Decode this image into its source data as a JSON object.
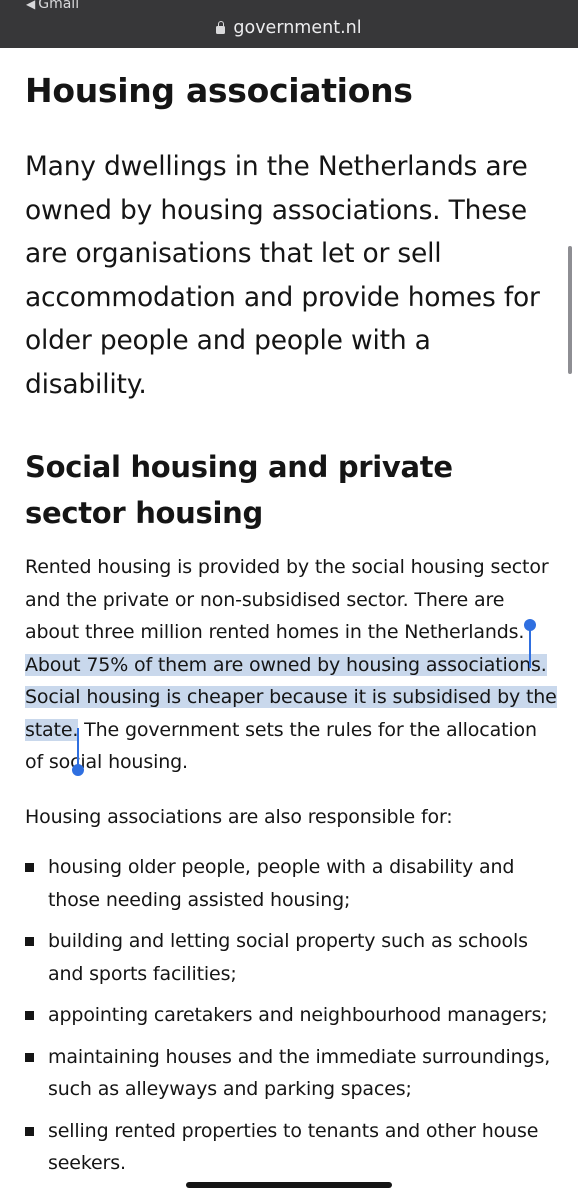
{
  "status_bar": {
    "back_label": "Gmail"
  },
  "browser": {
    "url": "government.nl"
  },
  "page": {
    "title": "Housing associations",
    "intro": "Many dwellings in the Netherlands are owned by housing associations. These are organisations that let or sell accommodation and provide homes for older people and people with a disability.",
    "section_heading": "Social housing and private sector housing",
    "paragraph": {
      "before_selection": "Rented housing is provided by the social housing sector and the private or non-subsidised sector. There are about three million rented homes in the Netherlands. ",
      "selected": "About 75% of them are owned by housing associations. Social housing is cheaper because it is subsidised by the state.",
      "after_selection": " The government sets the rules for the allocation of social housing."
    },
    "list_intro": "Housing associations are also responsible for:",
    "list_items": [
      "housing older people, people with a disability and those needing assisted housing;",
      "building and letting social property such as schools and sports facilities;",
      "appointing caretakers and neighbourhood managers;",
      "maintaining houses and the immediate surroundings, such as alleyways and parking spaces;",
      "selling rented properties to tenants and other house seekers."
    ]
  },
  "colors": {
    "toolbar": "#373739",
    "selection_highlight": "#c9d8ec",
    "selection_handle": "#2f6fe0"
  }
}
